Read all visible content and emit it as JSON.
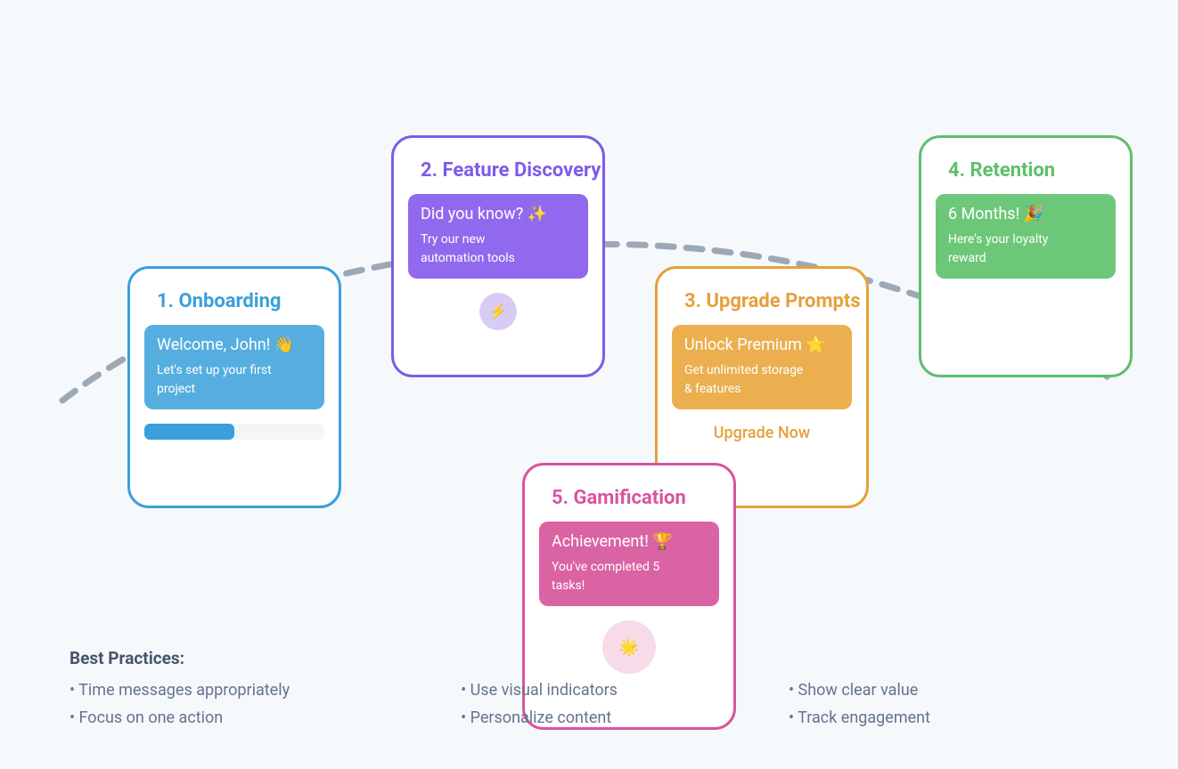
{
  "cards": {
    "onboarding": {
      "heading": "1. Onboarding",
      "notif_title": "Welcome, John! 👋",
      "notif_body": "Let's set up your first project",
      "progress_percent": 50
    },
    "feature": {
      "heading": "2. Feature Discovery",
      "notif_title": "Did you know? ✨",
      "notif_body": "Try our new automation tools",
      "icon": "⚡"
    },
    "upgrade": {
      "heading": "3. Upgrade Prompts",
      "notif_title": "Unlock Premium ⭐",
      "notif_body": "Get unlimited storage & features",
      "cta": "Upgrade Now"
    },
    "retention": {
      "heading": "4. Retention",
      "notif_title": "6 Months! 🎉",
      "notif_body": "Here's your loyalty reward"
    },
    "gamification": {
      "heading": "5. Gamification",
      "notif_title": "Achievement! 🏆",
      "notif_body": "You've completed 5 tasks!",
      "icon": "🌟"
    }
  },
  "practices": {
    "heading": "Best Practices:",
    "items": [
      "• Time messages appropriately",
      "• Use visual indicators",
      "• Show clear value",
      "• Focus on one action",
      "• Personalize content",
      "• Track engagement"
    ]
  },
  "colors": {
    "blue": "#3b9fdc",
    "purple": "#7c5ce8",
    "orange": "#e6a03c",
    "green": "#5fbf6c",
    "pink": "#d9549f",
    "path": "#9ca8b5"
  }
}
